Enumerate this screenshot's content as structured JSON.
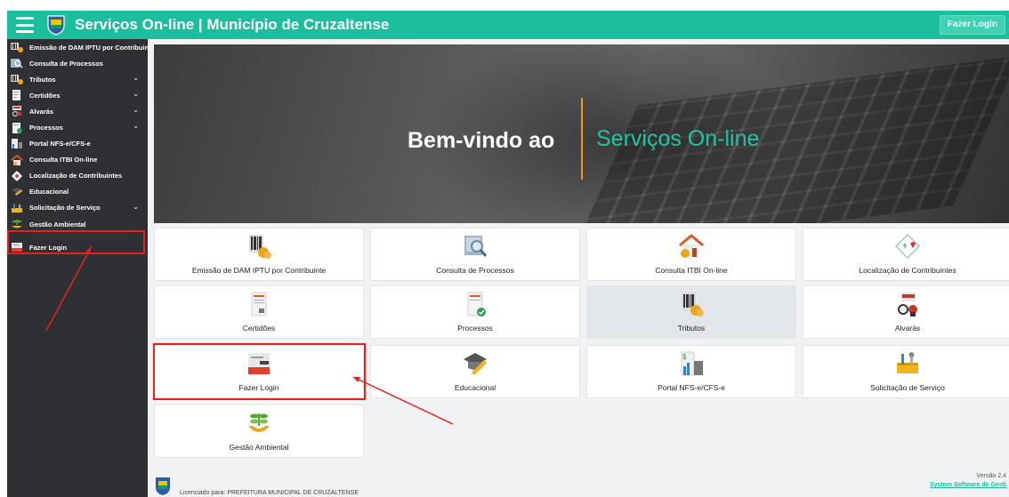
{
  "header": {
    "title": "Serviços On-line | Município de Cruzaltense",
    "login_button": "Fazer Login",
    "accent": "#1bbf9e"
  },
  "sidebar": {
    "items": [
      {
        "label": "Emissão de DAM IPTU por Contribuinte",
        "icon": "barcode-coins-icon",
        "expandable": false
      },
      {
        "label": "Consulta de Processos",
        "icon": "magnifier-doc-icon",
        "expandable": false
      },
      {
        "label": "Tributos",
        "icon": "barcode-coins-icon",
        "expandable": true
      },
      {
        "label": "Certidões",
        "icon": "document-icon",
        "expandable": true
      },
      {
        "label": "Alvarás",
        "icon": "license-icon",
        "expandable": true
      },
      {
        "label": "Processos",
        "icon": "document-check-icon",
        "expandable": true
      },
      {
        "label": "Portal NFS-e/CFS-e",
        "icon": "invoice-icon",
        "expandable": false
      },
      {
        "label": "Consulta ITBI On-line",
        "icon": "house-icon",
        "expandable": false
      },
      {
        "label": "Localização de Contribuintes",
        "icon": "map-pin-icon",
        "expandable": false
      },
      {
        "label": "Educacional",
        "icon": "graduation-icon",
        "expandable": false
      },
      {
        "label": "Solicitação de Serviço",
        "icon": "tools-icon",
        "expandable": true
      },
      {
        "label": "Gestão Ambiental",
        "icon": "plant-hands-icon",
        "expandable": false
      },
      {
        "label": "Fazer Login",
        "icon": "login-icon",
        "expandable": false
      }
    ]
  },
  "hero": {
    "welcome": "Bem-vindo ao",
    "product": "Serviços On-line"
  },
  "tiles": [
    {
      "label": "Emissão de DAM IPTU por Contribuinte",
      "icon": "barcode-coins-icon"
    },
    {
      "label": "Consulta de Processos",
      "icon": "magnifier-doc-icon"
    },
    {
      "label": "Consulta ITBI On-line",
      "icon": "house-icon"
    },
    {
      "label": "Localização de Contribuintes",
      "icon": "map-pin-icon"
    },
    {
      "label": "Certidões",
      "icon": "document-icon"
    },
    {
      "label": "Processos",
      "icon": "document-check-icon"
    },
    {
      "label": "Tributos",
      "icon": "barcode-coins-icon"
    },
    {
      "label": "Alvarás",
      "icon": "license-icon"
    },
    {
      "label": "Fazer Login",
      "icon": "login-icon"
    },
    {
      "label": "Educacional",
      "icon": "graduation-icon"
    },
    {
      "label": "Portal NFS-e/CFS-e",
      "icon": "invoice-icon"
    },
    {
      "label": "Solicitação de Serviço",
      "icon": "tools-icon"
    },
    {
      "label": "Gestão Ambiental",
      "icon": "plant-hands-icon"
    }
  ],
  "footer": {
    "licensed_prefix": "Licenciado para:",
    "licensed_to": "PREFEITURA MUNICIPAL DE CRUZALTENSE",
    "version": "Versão 2.4",
    "vendor": "System Software de Gesti"
  }
}
